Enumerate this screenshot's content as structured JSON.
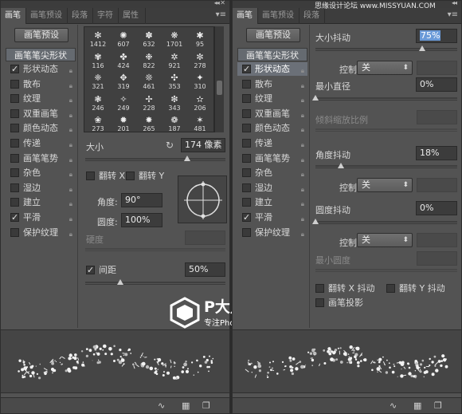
{
  "left": {
    "tabs": [
      "画笔",
      "画笔预设",
      "段落",
      "字符",
      "属性"
    ],
    "preset_button": "画笔预设",
    "tip_shape_label": "画笔笔尖形状",
    "options": [
      {
        "label": "形状动态",
        "checked": true,
        "selected": false
      },
      {
        "label": "散布",
        "checked": false,
        "selected": false
      },
      {
        "label": "纹理",
        "checked": false,
        "selected": false
      },
      {
        "label": "双重画笔",
        "checked": false,
        "selected": false
      },
      {
        "label": "颜色动态",
        "checked": false,
        "selected": false
      },
      {
        "label": "传递",
        "checked": false,
        "selected": false
      },
      {
        "label": "画笔笔势",
        "checked": false,
        "selected": false
      },
      {
        "label": "杂色",
        "checked": false,
        "selected": false
      },
      {
        "label": "湿边",
        "checked": false,
        "selected": false
      },
      {
        "label": "建立",
        "checked": false,
        "selected": false
      },
      {
        "label": "平滑",
        "checked": true,
        "selected": false
      },
      {
        "label": "保护纹理",
        "checked": false,
        "selected": false
      }
    ],
    "brush_sizes": [
      "1412",
      "607",
      "632",
      "1701",
      "95",
      "116",
      "424",
      "822",
      "921",
      "278",
      "321",
      "319",
      "461",
      "353",
      "310",
      "246",
      "249",
      "228",
      "343",
      "206",
      "273",
      "201",
      "265",
      "187",
      "481"
    ],
    "size_label": "大小",
    "size_value": "174 像素",
    "size_slider": 0.73,
    "flip_x": "翻转 X",
    "flip_y": "翻转 Y",
    "angle_label": "角度:",
    "angle_value": "90°",
    "roundness_label": "圆度:",
    "roundness_value": "100%",
    "hardness_label": "硬度",
    "spacing_label": "间距",
    "spacing_checked": true,
    "spacing_value": "50%",
    "spacing_slider": 0.25,
    "watermark_title": "P大点S",
    "watermark_sub": "专注Photoshop教程"
  },
  "right": {
    "tabs": [
      "画笔",
      "画笔预设",
      "段落"
    ],
    "preset_button": "画笔预设",
    "tip_shape_label": "画笔笔尖形状",
    "options": [
      {
        "label": "形状动态",
        "checked": true,
        "selected": true
      },
      {
        "label": "散布",
        "checked": false,
        "selected": false
      },
      {
        "label": "纹理",
        "checked": false,
        "selected": false
      },
      {
        "label": "双重画笔",
        "checked": false,
        "selected": false
      },
      {
        "label": "颜色动态",
        "checked": false,
        "selected": false
      },
      {
        "label": "传递",
        "checked": false,
        "selected": false
      },
      {
        "label": "画笔笔势",
        "checked": false,
        "selected": false
      },
      {
        "label": "杂色",
        "checked": false,
        "selected": false
      },
      {
        "label": "湿边",
        "checked": false,
        "selected": false
      },
      {
        "label": "建立",
        "checked": false,
        "selected": false
      },
      {
        "label": "平滑",
        "checked": true,
        "selected": false
      },
      {
        "label": "保护纹理",
        "checked": false,
        "selected": false
      }
    ],
    "size_jitter_label": "大小抖动",
    "size_jitter_value": "75%",
    "size_jitter_slider": 0.75,
    "control_label": "控制:",
    "control_value": "关",
    "min_diameter_label": "最小直径",
    "min_diameter_value": "0%",
    "min_diameter_slider": 0.0,
    "tilt_scale_label": "倾斜缩放比例",
    "angle_jitter_label": "角度抖动",
    "angle_jitter_value": "18%",
    "angle_jitter_slider": 0.18,
    "control2_label": "控制:",
    "control2_value": "关",
    "roundness_jitter_label": "圆度抖动",
    "roundness_jitter_value": "0%",
    "roundness_jitter_slider": 0.0,
    "control3_label": "控制:",
    "control3_value": "关",
    "min_roundness_label": "最小圆度",
    "flip_x_jitter": "翻转 X 抖动",
    "flip_y_jitter": "翻转 Y 抖动",
    "brush_projection": "画笔投影"
  },
  "watermark_site": "思缘设计论坛 www.MISSYUAN.COM"
}
